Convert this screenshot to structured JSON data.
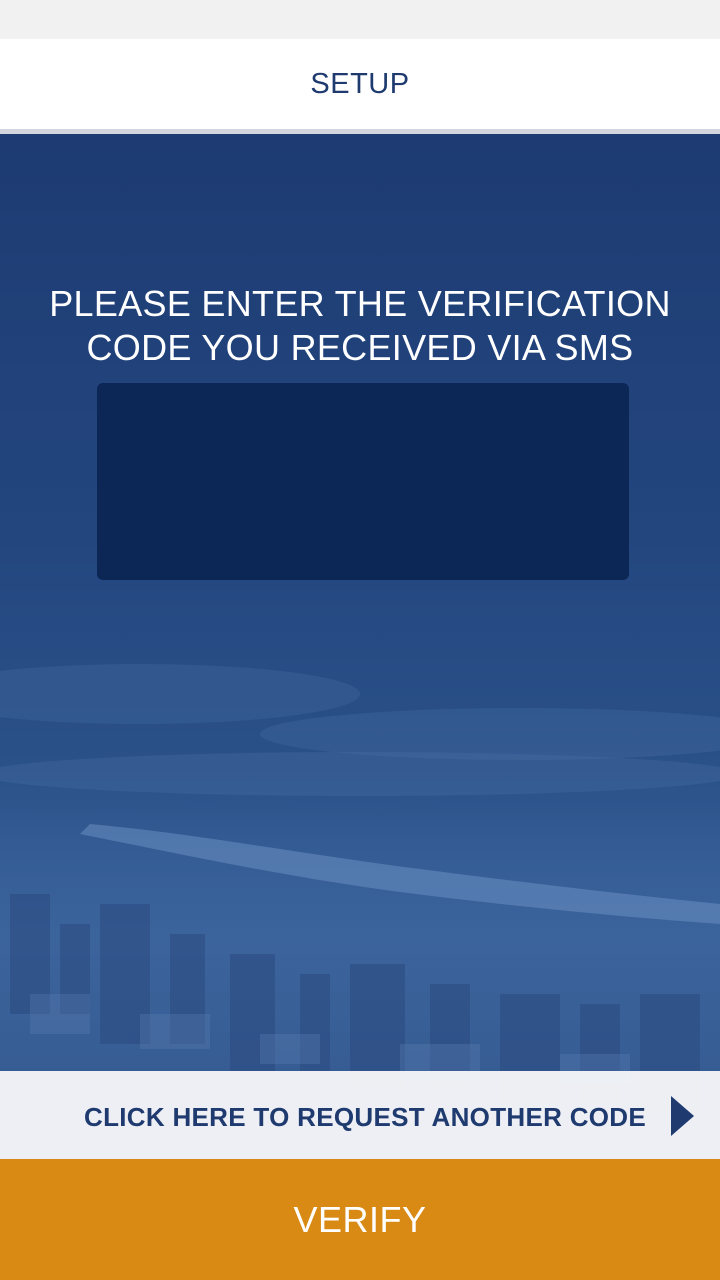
{
  "header": {
    "title": "SETUP"
  },
  "main": {
    "prompt_line1": "PLEASE ENTER THE VERIFICATION",
    "prompt_line2": "CODE YOU RECEIVED VIA SMS",
    "code_input": {
      "value": "",
      "placeholder": ""
    }
  },
  "actions": {
    "request_code_label": "CLICK HERE TO REQUEST ANOTHER CODE",
    "request_code_icon": "chevron-right-icon",
    "verify_label": "VERIFY"
  },
  "colors": {
    "brand_blue": "#1e3a6f",
    "input_bg": "#0c2756",
    "accent_orange": "#d98a14"
  }
}
